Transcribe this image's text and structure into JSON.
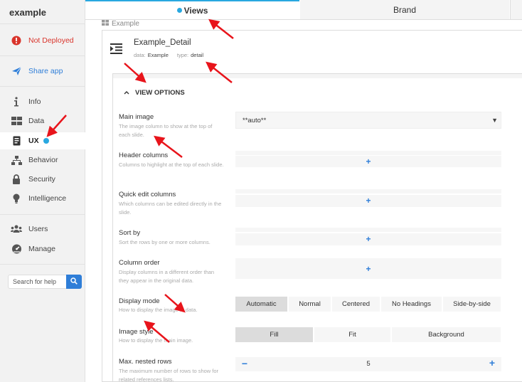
{
  "app": {
    "name": "example"
  },
  "sidebar": {
    "status": {
      "label": "Not Deployed",
      "icon": "alert-circle-icon",
      "color": "#d9342b"
    },
    "share": {
      "label": "Share app",
      "icon": "send-icon"
    },
    "items": [
      {
        "label": "Info",
        "icon": "info-icon"
      },
      {
        "label": "Data",
        "icon": "grid-icon"
      },
      {
        "label": "UX",
        "icon": "phone-ux-icon",
        "active": true
      },
      {
        "label": "Behavior",
        "icon": "hierarchy-icon"
      },
      {
        "label": "Security",
        "icon": "lock-icon"
      },
      {
        "label": "Intelligence",
        "icon": "lightbulb-icon"
      },
      {
        "label": "Users",
        "icon": "users-icon"
      },
      {
        "label": "Manage",
        "icon": "dashboard-icon"
      }
    ],
    "search": {
      "placeholder": "Search for help",
      "icon": "search-icon"
    }
  },
  "tabs": [
    {
      "label": "Views",
      "active": true
    },
    {
      "label": "Brand",
      "active": false
    }
  ],
  "breadcrumb": {
    "label": "Example",
    "icon": "table-icon"
  },
  "view": {
    "name": "Example_Detail",
    "data_key": "data:",
    "data_value": "Example",
    "type_key": "type:",
    "type_value": "detail",
    "icon": "detail-view-icon"
  },
  "view_options": {
    "title": "VIEW OPTIONS",
    "main_image": {
      "label": "Main image",
      "help": "The image column to show at the top of each slide.",
      "value": "**auto**"
    },
    "header_columns": {
      "label": "Header columns",
      "help": "Columns to highlight at the top of each slide."
    },
    "quick_edit": {
      "label": "Quick edit columns",
      "help": "Which columns can be edited directly in the slide."
    },
    "sort_by": {
      "label": "Sort by",
      "help": "Sort the rows by one or more columns."
    },
    "column_order": {
      "label": "Column order",
      "help": "Display columns in a different order than they appear in the original data."
    },
    "display_mode": {
      "label": "Display mode",
      "help": "How to display the image in data.",
      "options": [
        "Automatic",
        "Normal",
        "Centered",
        "No Headings",
        "Side-by-side"
      ],
      "selected": "Automatic"
    },
    "image_style": {
      "label": "Image style",
      "help": "How to display the main image.",
      "options": [
        "Fill",
        "Fit",
        "Background"
      ],
      "selected": "Fill"
    },
    "max_nested": {
      "label": "Max. nested rows",
      "help": "The maximum number of rows to show for related references lists.",
      "value": "5"
    },
    "add_symbol": "+",
    "minus_symbol": "−"
  },
  "colors": {
    "accent": "#29a8e0",
    "link": "#2f7ed8",
    "annotation_arrow": "#e8141b"
  }
}
